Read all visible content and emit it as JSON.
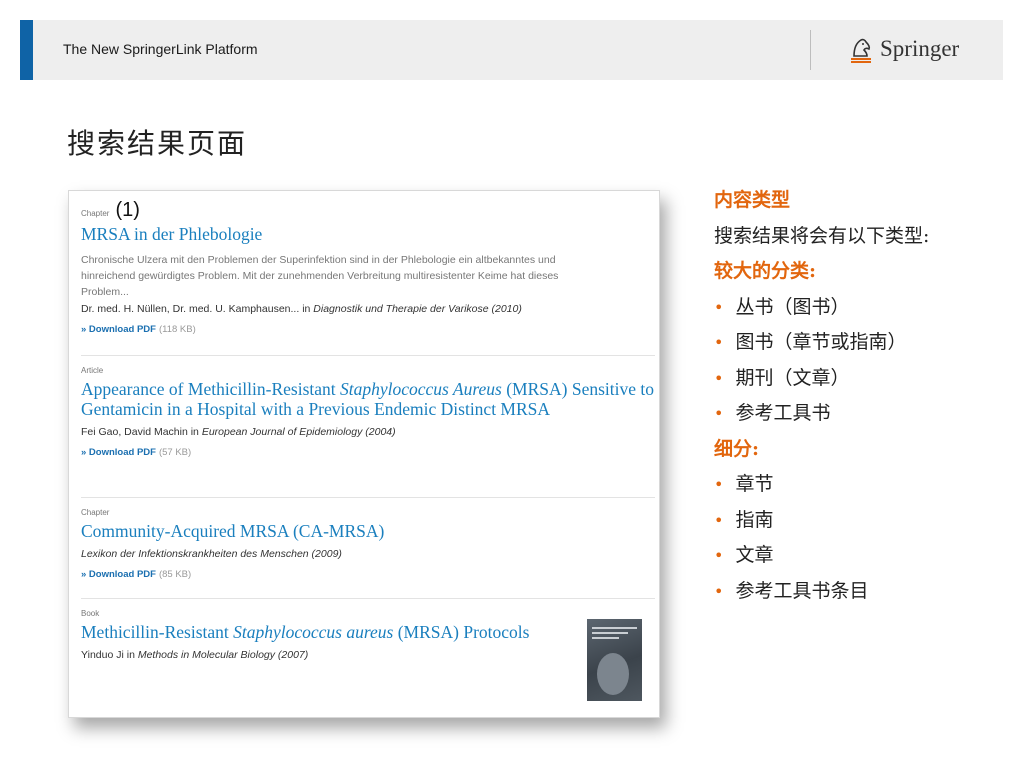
{
  "header": {
    "title": "The New SpringerLink Platform",
    "logo_text": "Springer",
    "accent_color": "#0f63a6"
  },
  "page_title": "搜索结果页面",
  "results": [
    {
      "type": "Chapter",
      "annotation": "(1)",
      "title": "MRSA in der Phlebologie",
      "snippet": "Chronische Ulzera mit den Problemen der Superinfektion sind in der Phlebologie ein altbekanntes und hinreichend gewürdigtes Problem. Mit der zunehmenden Verbreitung multiresistenter Keime hat dieses Problem...",
      "authors": "Dr. med. H. Nüllen, Dr. med. U. Kamphausen...",
      "in": "in",
      "source": "Diagnostik und Therapie der Varikose (2010)",
      "download_label": "» Download PDF",
      "download_size": "(118 KB)"
    },
    {
      "type": "Article",
      "title_pre": "Appearance of Methicillin-Resistant ",
      "title_italic": "Staphylococcus Aureus",
      "title_post": " (MRSA) Sensitive to Gentamicin in a Hospital with a Previous Endemic Distinct MRSA",
      "authors": "Fei Gao, David Machin",
      "in": "in",
      "source": "European Journal of Epidemiology (2004)",
      "download_label": "» Download PDF",
      "download_size": "(57 KB)"
    },
    {
      "type": "Chapter",
      "title": "Community-Acquired MRSA (CA-MRSA)",
      "source": "Lexikon der Infektionskrankheiten des Menschen (2009)",
      "download_label": "» Download PDF",
      "download_size": "(85 KB)"
    },
    {
      "type": "Book",
      "title_pre": "Methicillin-Resistant ",
      "title_italic": "Staphylococcus aureus",
      "title_post": " (MRSA) Protocols",
      "authors": "Yinduo Ji",
      "in": "in",
      "source": "Methods in Molecular Biology (2007)"
    }
  ],
  "panel": {
    "heading1": "内容类型",
    "intro": "搜索结果将会有以下类型:",
    "heading2": "较大的分类:",
    "major": [
      "丛书（图书）",
      "图书（章节或指南）",
      "期刊（文章）",
      "参考工具书"
    ],
    "heading3": "细分:",
    "minor": [
      "章节",
      "指南",
      "文章",
      "参考工具书条目"
    ],
    "bullet": "•",
    "accent_color": "#e2660e"
  }
}
